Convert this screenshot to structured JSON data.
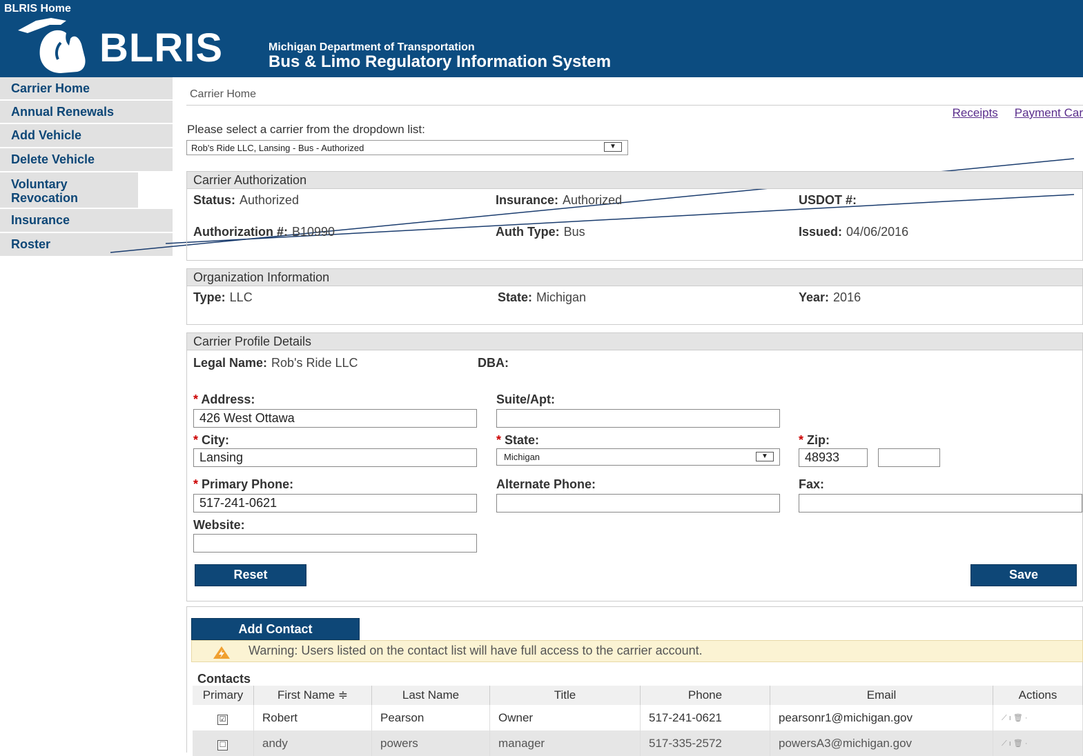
{
  "header": {
    "home_link": "BLRIS Home",
    "logo_text": "BLRIS",
    "dept": "Michigan Department of Transportation",
    "system": "Bus & Limo Regulatory Information System"
  },
  "sidebar": {
    "items": [
      {
        "label": "Carrier Home"
      },
      {
        "label": "Annual Renewals"
      },
      {
        "label": "Add Vehicle"
      },
      {
        "label": "Delete Vehicle"
      },
      {
        "label": "Voluntary Revocation"
      },
      {
        "label": "Insurance"
      },
      {
        "label": "Roster"
      }
    ]
  },
  "main": {
    "breadcrumb": "Carrier Home",
    "links": [
      "Receipts",
      "Payment Car"
    ],
    "select_label": "Please select a carrier from the dropdown list:",
    "carrier_selected": "Rob's Ride LLC, Lansing - Bus - Authorized"
  },
  "authorization": {
    "title": "Carrier Authorization",
    "status_label": "Status:",
    "status": "Authorized",
    "insurance_label": "Insurance:",
    "insurance": "Authorized",
    "usdot_label": "USDOT #:",
    "auth_no_label": "Authorization #:",
    "auth_no": "B10990",
    "auth_type_label": "Auth Type:",
    "auth_type": "Bus",
    "issued_label": "Issued:",
    "issued": "04/06/2016"
  },
  "organization": {
    "title": "Organization Information",
    "type_label": "Type:",
    "type": "LLC",
    "state_label": "State:",
    "state": "Michigan",
    "year_label": "Year:",
    "year": "2016"
  },
  "profile": {
    "title": "Carrier Profile Details",
    "legal_label": "Legal Name:",
    "legal_name": "Rob's Ride LLC",
    "dba_label": "DBA:",
    "address_label": "Address:",
    "address": "426 West Ottawa",
    "suite_label": "Suite/Apt:",
    "suite": "",
    "city_label": "City:",
    "city": "Lansing",
    "state_label": "State:",
    "state": "Michigan",
    "zip_label": "Zip:",
    "zip": "48933",
    "zip_ext": "",
    "primary_phone_label": "Primary Phone:",
    "primary_phone": "517-241-0621",
    "alt_phone_label": "Alternate Phone:",
    "alt_phone": "",
    "fax_label": "Fax:",
    "fax": "",
    "website_label": "Website:",
    "website": "",
    "reset_label": "Reset",
    "save_label": "Save",
    "required_mark": "*"
  },
  "contacts": {
    "add_label": "Add Contact",
    "warning": "Warning: Users listed on the contact list will have full access to the carrier account.",
    "title": "Contacts",
    "columns": [
      "Primary",
      "First Name ≑",
      "Last Name",
      "Title",
      "Phone",
      "Email",
      "Actions"
    ],
    "rows": [
      {
        "primary": "☑",
        "first": "Robert",
        "last": "Pearson",
        "title": "Owner",
        "phone": "517-241-0621",
        "email": "pearsonr1@michigan.gov",
        "actions": "⟋ ı 🗑 ·"
      },
      {
        "primary": "☐",
        "first": "andy",
        "last": "powers",
        "title": "manager",
        "phone": "517-335-2572",
        "email": "powersA3@michigan.gov",
        "actions": "⟋ ı 🗑 ·"
      }
    ]
  },
  "colors": {
    "header_bg": "#0c4c80",
    "nav_text": "#0e4777",
    "button_bg": "#0e4777",
    "warning_bg": "#fbf3d3",
    "link_color": "#5a2e8c"
  }
}
